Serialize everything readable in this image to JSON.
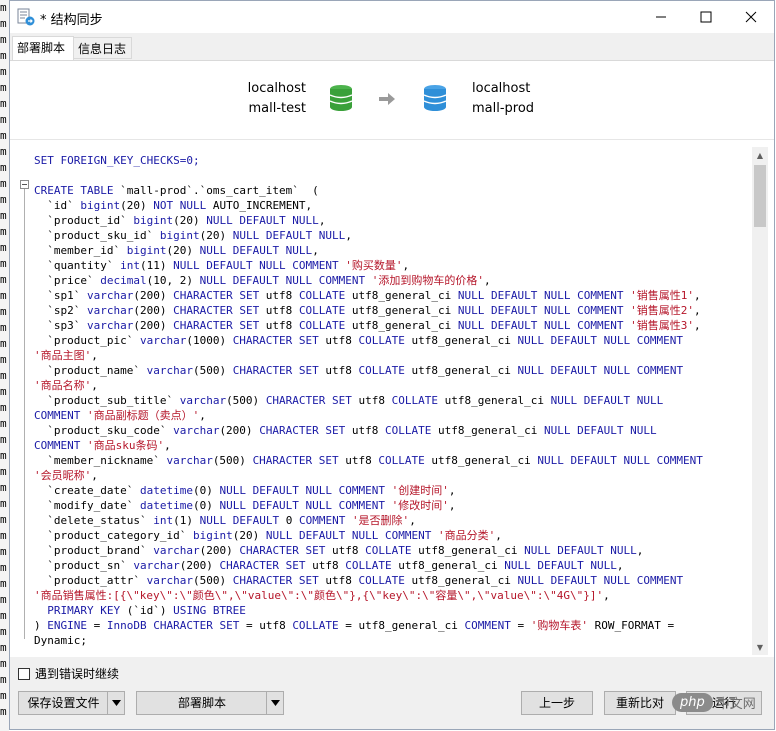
{
  "left_strip_chars": [
    "m",
    "m",
    "m",
    "m",
    "m",
    "m",
    "m",
    "m",
    "m",
    "m",
    "m",
    "m",
    "m",
    "m",
    "m",
    "m",
    "m",
    "m",
    "m",
    "m",
    "m",
    "m",
    "m",
    "m",
    "m",
    "m",
    "m",
    "m",
    "m",
    "m",
    "m",
    "m",
    "m",
    "m",
    "m",
    "m",
    "m",
    "m",
    "m",
    "m",
    "m",
    "m",
    "m",
    "m",
    "m"
  ],
  "window": {
    "title": "* 结构同步"
  },
  "tabs": [
    {
      "label": "部署脚本"
    },
    {
      "label": "信息日志"
    }
  ],
  "sync": {
    "source": {
      "host": "localhost",
      "db": "mall-test",
      "color": "#3aa03a"
    },
    "target": {
      "host": "localhost",
      "db": "mall-prod",
      "color": "#2f8fd8"
    }
  },
  "code_lines": [
    [
      [
        "SET FOREIGN_KEY_CHECKS=0;",
        "kw"
      ]
    ],
    [],
    [
      [
        "CREATE TABLE",
        "kw"
      ],
      [
        " `mall-prod`.`oms_cart_item`  (",
        ""
      ]
    ],
    [
      [
        "  `id` ",
        ""
      ],
      [
        "bigint",
        "kw"
      ],
      [
        "(20) ",
        ""
      ],
      [
        "NOT NULL",
        "kw"
      ],
      [
        " AUTO_INCREMENT,",
        ""
      ]
    ],
    [
      [
        "  `product_id` ",
        ""
      ],
      [
        "bigint",
        "kw"
      ],
      [
        "(20) ",
        ""
      ],
      [
        "NULL DEFAULT NULL",
        "kw"
      ],
      [
        ",",
        ""
      ]
    ],
    [
      [
        "  `product_sku_id` ",
        ""
      ],
      [
        "bigint",
        "kw"
      ],
      [
        "(20) ",
        ""
      ],
      [
        "NULL DEFAULT NULL",
        "kw"
      ],
      [
        ",",
        ""
      ]
    ],
    [
      [
        "  `member_id` ",
        ""
      ],
      [
        "bigint",
        "kw"
      ],
      [
        "(20) ",
        ""
      ],
      [
        "NULL DEFAULT NULL",
        "kw"
      ],
      [
        ",",
        ""
      ]
    ],
    [
      [
        "  `quantity` ",
        ""
      ],
      [
        "int",
        "kw"
      ],
      [
        "(11) ",
        ""
      ],
      [
        "NULL DEFAULT NULL COMMENT",
        "kw"
      ],
      [
        " ",
        ""
      ],
      [
        "'购买数量'",
        "str"
      ],
      [
        ",",
        ""
      ]
    ],
    [
      [
        "  `price` ",
        ""
      ],
      [
        "decimal",
        "kw"
      ],
      [
        "(10, 2) ",
        ""
      ],
      [
        "NULL DEFAULT NULL COMMENT",
        "kw"
      ],
      [
        " ",
        ""
      ],
      [
        "'添加到购物车的价格'",
        "str"
      ],
      [
        ",",
        ""
      ]
    ],
    [
      [
        "  `sp1` ",
        ""
      ],
      [
        "varchar",
        "kw"
      ],
      [
        "(200) ",
        ""
      ],
      [
        "CHARACTER SET",
        "kw"
      ],
      [
        " utf8 ",
        ""
      ],
      [
        "COLLATE",
        "kw"
      ],
      [
        " utf8_general_ci ",
        ""
      ],
      [
        "NULL DEFAULT NULL COMMENT",
        "kw"
      ],
      [
        " ",
        ""
      ],
      [
        "'销售属性1'",
        "str"
      ],
      [
        ",",
        ""
      ]
    ],
    [
      [
        "  `sp2` ",
        ""
      ],
      [
        "varchar",
        "kw"
      ],
      [
        "(200) ",
        ""
      ],
      [
        "CHARACTER SET",
        "kw"
      ],
      [
        " utf8 ",
        ""
      ],
      [
        "COLLATE",
        "kw"
      ],
      [
        " utf8_general_ci ",
        ""
      ],
      [
        "NULL DEFAULT NULL COMMENT",
        "kw"
      ],
      [
        " ",
        ""
      ],
      [
        "'销售属性2'",
        "str"
      ],
      [
        ",",
        ""
      ]
    ],
    [
      [
        "  `sp3` ",
        ""
      ],
      [
        "varchar",
        "kw"
      ],
      [
        "(200) ",
        ""
      ],
      [
        "CHARACTER SET",
        "kw"
      ],
      [
        " utf8 ",
        ""
      ],
      [
        "COLLATE",
        "kw"
      ],
      [
        " utf8_general_ci ",
        ""
      ],
      [
        "NULL DEFAULT NULL COMMENT",
        "kw"
      ],
      [
        " ",
        ""
      ],
      [
        "'销售属性3'",
        "str"
      ],
      [
        ",",
        ""
      ]
    ],
    [
      [
        "  `product_pic` ",
        ""
      ],
      [
        "varchar",
        "kw"
      ],
      [
        "(1000) ",
        ""
      ],
      [
        "CHARACTER SET",
        "kw"
      ],
      [
        " utf8 ",
        ""
      ],
      [
        "COLLATE",
        "kw"
      ],
      [
        " utf8_general_ci ",
        ""
      ],
      [
        "NULL DEFAULT NULL COMMENT",
        "kw"
      ]
    ],
    [
      [
        "'商品主图'",
        "str"
      ],
      [
        ",",
        ""
      ]
    ],
    [
      [
        "  `product_name` ",
        ""
      ],
      [
        "varchar",
        "kw"
      ],
      [
        "(500) ",
        ""
      ],
      [
        "CHARACTER SET",
        "kw"
      ],
      [
        " utf8 ",
        ""
      ],
      [
        "COLLATE",
        "kw"
      ],
      [
        " utf8_general_ci ",
        ""
      ],
      [
        "NULL DEFAULT NULL COMMENT",
        "kw"
      ]
    ],
    [
      [
        "'商品名称'",
        "str"
      ],
      [
        ",",
        ""
      ]
    ],
    [
      [
        "  `product_sub_title` ",
        ""
      ],
      [
        "varchar",
        "kw"
      ],
      [
        "(500) ",
        ""
      ],
      [
        "CHARACTER SET",
        "kw"
      ],
      [
        " utf8 ",
        ""
      ],
      [
        "COLLATE",
        "kw"
      ],
      [
        " utf8_general_ci ",
        ""
      ],
      [
        "NULL DEFAULT NULL",
        "kw"
      ]
    ],
    [
      [
        "COMMENT",
        "kw"
      ],
      [
        " ",
        ""
      ],
      [
        "'商品副标题（卖点）'",
        "str"
      ],
      [
        ",",
        ""
      ]
    ],
    [
      [
        "  `product_sku_code` ",
        ""
      ],
      [
        "varchar",
        "kw"
      ],
      [
        "(200) ",
        ""
      ],
      [
        "CHARACTER SET",
        "kw"
      ],
      [
        " utf8 ",
        ""
      ],
      [
        "COLLATE",
        "kw"
      ],
      [
        " utf8_general_ci ",
        ""
      ],
      [
        "NULL DEFAULT NULL",
        "kw"
      ]
    ],
    [
      [
        "COMMENT",
        "kw"
      ],
      [
        " ",
        ""
      ],
      [
        "'商品sku条码'",
        "str"
      ],
      [
        ",",
        ""
      ]
    ],
    [
      [
        "  `member_nickname` ",
        ""
      ],
      [
        "varchar",
        "kw"
      ],
      [
        "(500) ",
        ""
      ],
      [
        "CHARACTER SET",
        "kw"
      ],
      [
        " utf8 ",
        ""
      ],
      [
        "COLLATE",
        "kw"
      ],
      [
        " utf8_general_ci ",
        ""
      ],
      [
        "NULL DEFAULT NULL COMMENT",
        "kw"
      ]
    ],
    [
      [
        "'会员昵称'",
        "str"
      ],
      [
        ",",
        ""
      ]
    ],
    [
      [
        "  `create_date` ",
        ""
      ],
      [
        "datetime",
        "kw"
      ],
      [
        "(0) ",
        ""
      ],
      [
        "NULL DEFAULT NULL COMMENT",
        "kw"
      ],
      [
        " ",
        ""
      ],
      [
        "'创建时间'",
        "str"
      ],
      [
        ",",
        ""
      ]
    ],
    [
      [
        "  `modify_date` ",
        ""
      ],
      [
        "datetime",
        "kw"
      ],
      [
        "(0) ",
        ""
      ],
      [
        "NULL DEFAULT NULL COMMENT",
        "kw"
      ],
      [
        " ",
        ""
      ],
      [
        "'修改时间'",
        "str"
      ],
      [
        ",",
        ""
      ]
    ],
    [
      [
        "  `delete_status` ",
        ""
      ],
      [
        "int",
        "kw"
      ],
      [
        "(1) ",
        ""
      ],
      [
        "NULL DEFAULT",
        "kw"
      ],
      [
        " 0 ",
        ""
      ],
      [
        "COMMENT",
        "kw"
      ],
      [
        " ",
        ""
      ],
      [
        "'是否删除'",
        "str"
      ],
      [
        ",",
        ""
      ]
    ],
    [
      [
        "  `product_category_id` ",
        ""
      ],
      [
        "bigint",
        "kw"
      ],
      [
        "(20) ",
        ""
      ],
      [
        "NULL DEFAULT NULL COMMENT",
        "kw"
      ],
      [
        " ",
        ""
      ],
      [
        "'商品分类'",
        "str"
      ],
      [
        ",",
        ""
      ]
    ],
    [
      [
        "  `product_brand` ",
        ""
      ],
      [
        "varchar",
        "kw"
      ],
      [
        "(200) ",
        ""
      ],
      [
        "CHARACTER SET",
        "kw"
      ],
      [
        " utf8 ",
        ""
      ],
      [
        "COLLATE",
        "kw"
      ],
      [
        " utf8_general_ci ",
        ""
      ],
      [
        "NULL DEFAULT NULL",
        "kw"
      ],
      [
        ",",
        ""
      ]
    ],
    [
      [
        "  `product_sn` ",
        ""
      ],
      [
        "varchar",
        "kw"
      ],
      [
        "(200) ",
        ""
      ],
      [
        "CHARACTER SET",
        "kw"
      ],
      [
        " utf8 ",
        ""
      ],
      [
        "COLLATE",
        "kw"
      ],
      [
        " utf8_general_ci ",
        ""
      ],
      [
        "NULL DEFAULT NULL",
        "kw"
      ],
      [
        ",",
        ""
      ]
    ],
    [
      [
        "  `product_attr` ",
        ""
      ],
      [
        "varchar",
        "kw"
      ],
      [
        "(500) ",
        ""
      ],
      [
        "CHARACTER SET",
        "kw"
      ],
      [
        " utf8 ",
        ""
      ],
      [
        "COLLATE",
        "kw"
      ],
      [
        " utf8_general_ci ",
        ""
      ],
      [
        "NULL DEFAULT NULL COMMENT",
        "kw"
      ]
    ],
    [
      [
        "'商品销售属性:[{\\\"key\\\":\\\"颜色\\\",\\\"value\\\":\\\"颜色\\\"},{\\\"key\\\":\\\"容量\\\",\\\"value\\\":\\\"4G\\\"}]'",
        "str"
      ],
      [
        ",",
        ""
      ]
    ],
    [
      [
        "  PRIMARY KEY",
        "kw"
      ],
      [
        " (`id`) ",
        ""
      ],
      [
        "USING BTREE",
        "kw"
      ]
    ],
    [
      [
        ") ",
        ""
      ],
      [
        "ENGINE",
        "kw"
      ],
      [
        " = ",
        ""
      ],
      [
        "InnoDB CHARACTER SET",
        "kw"
      ],
      [
        " = utf8 ",
        ""
      ],
      [
        "COLLATE",
        "kw"
      ],
      [
        " = utf8_general_ci ",
        ""
      ],
      [
        "COMMENT",
        "kw"
      ],
      [
        " = ",
        ""
      ],
      [
        "'购物车表'",
        "str"
      ],
      [
        " ROW_FORMAT =",
        ""
      ]
    ],
    [
      [
        "Dynamic;",
        ""
      ]
    ]
  ],
  "options": {
    "continue_on_error_label": "遇到错误时继续",
    "checked": false
  },
  "buttons": {
    "save_settings": "保存设置文件",
    "deploy_script": "部署脚本",
    "previous": "上一步",
    "recompare": "重新比对",
    "run": "运行"
  },
  "watermark": {
    "badge": "php",
    "text": "中文网"
  }
}
